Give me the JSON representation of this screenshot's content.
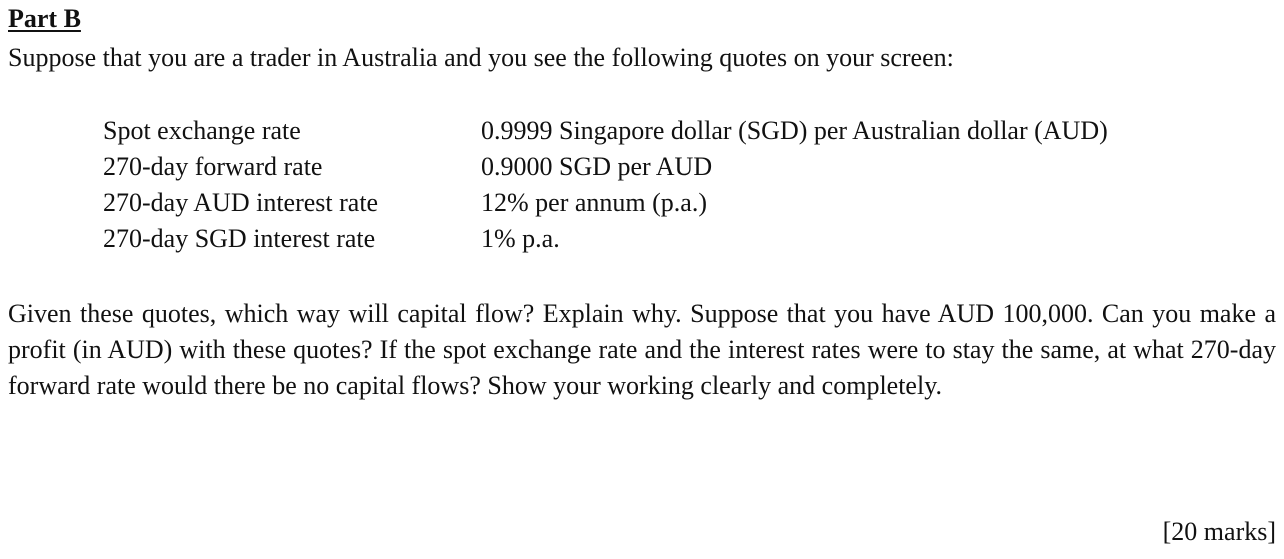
{
  "part": {
    "title": "Part B"
  },
  "intro": "Suppose that you are a trader in Australia and you see the following quotes on your screen:",
  "quotes": [
    {
      "label": "Spot exchange rate",
      "value": "0.9999 Singapore dollar (SGD) per Australian dollar (AUD)"
    },
    {
      "label": "270-day forward rate",
      "value": "0.9000 SGD per AUD"
    },
    {
      "label": "270-day AUD interest rate",
      "value": "12% per annum (p.a.)"
    },
    {
      "label": "270-day SGD interest rate",
      "value": "1% p.a."
    }
  ],
  "question": "Given these quotes, which way will capital flow? Explain why. Suppose that you have AUD 100,000. Can you make a profit (in AUD) with these quotes? If the spot exchange rate and the interest rates were to stay the same, at what 270-day forward rate would there be no capital flows? Show your working clearly and completely.",
  "marks": "[20 marks]"
}
